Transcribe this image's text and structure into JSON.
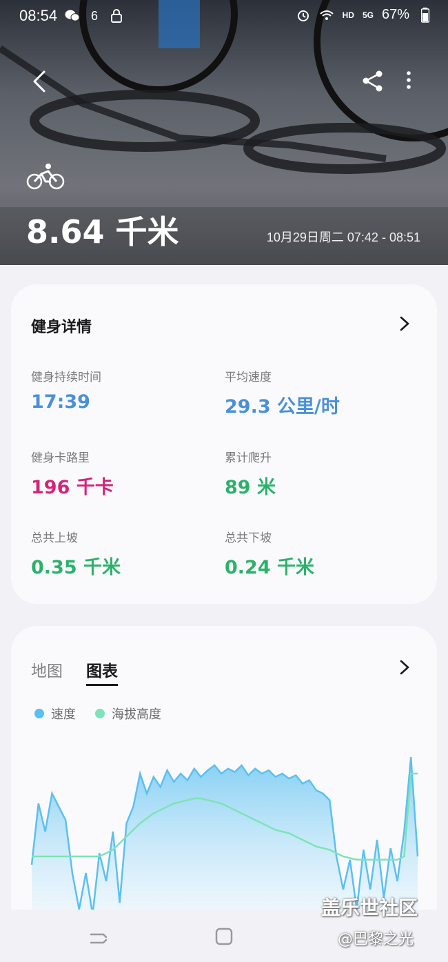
{
  "status_bar": {
    "time": "08:54",
    "left_icons": [
      "wechat-icon",
      "signal-6-icon",
      "lock-icon"
    ],
    "right_icons": [
      "alarm-icon",
      "wifi-icon",
      "hd-icon",
      "5g-icon",
      "battery-icon"
    ],
    "hd": "HD",
    "network": "5G",
    "battery": "67%"
  },
  "header": {
    "back_icon": "chevron-left-icon",
    "share_icon": "share-icon",
    "more_icon": "more-vertical-icon",
    "activity_icon": "bicycle-icon",
    "distance": "8.64 千米",
    "datetime": "10月29日周二 07:42 - 08:51"
  },
  "details": {
    "title": "健身详情",
    "stats": [
      {
        "label": "健身持续时间",
        "value": "17:39",
        "color": "#4a90d9"
      },
      {
        "label": "平均速度",
        "value": "29.3 公里/时",
        "color": "#4a90d9"
      },
      {
        "label": "健身卡路里",
        "value": "196 千卡",
        "color": "#d4237a"
      },
      {
        "label": "累计爬升",
        "value": "89 米",
        "color": "#2bb26a"
      },
      {
        "label": "总共上坡",
        "value": "0.35 千米",
        "color": "#2bb26a"
      },
      {
        "label": "总共下坡",
        "value": "0.24 千米",
        "color": "#2bb26a"
      }
    ]
  },
  "chart_card": {
    "tabs": [
      {
        "label": "地图",
        "selected": false
      },
      {
        "label": "图表",
        "selected": true
      }
    ],
    "legend": [
      {
        "label": "速度",
        "color": "#5bc0f0"
      },
      {
        "label": "海拔高度",
        "color": "#7de3b8"
      }
    ]
  },
  "chart_data": {
    "type": "area",
    "title": "",
    "xlabel": "",
    "ylabel": "",
    "series": [
      {
        "name": "速度",
        "color": "#5bc0f0",
        "values": [
          0.35,
          0.72,
          0.55,
          0.78,
          0.7,
          0.62,
          0.3,
          0.08,
          0.3,
          0.05,
          0.42,
          0.25,
          0.55,
          0.12,
          0.6,
          0.7,
          0.9,
          0.78,
          0.88,
          0.82,
          0.92,
          0.85,
          0.9,
          0.86,
          0.93,
          0.88,
          0.92,
          0.95,
          0.9,
          0.93,
          0.91,
          0.95,
          0.89,
          0.93,
          0.9,
          0.92,
          0.88,
          0.9,
          0.87,
          0.89,
          0.84,
          0.86,
          0.8,
          0.78,
          0.74,
          0.4,
          0.2,
          0.38,
          0.08,
          0.44,
          0.2,
          0.5,
          0.15,
          0.45,
          0.25,
          0.55,
          1.0,
          0.4
        ]
      },
      {
        "name": "海拔高度",
        "color": "#7de3b8",
        "values": [
          0.4,
          0.4,
          0.4,
          0.4,
          0.4,
          0.4,
          0.4,
          0.4,
          0.4,
          0.4,
          0.4,
          0.42,
          0.44,
          0.48,
          0.52,
          0.56,
          0.6,
          0.63,
          0.66,
          0.68,
          0.7,
          0.72,
          0.73,
          0.74,
          0.75,
          0.75,
          0.74,
          0.73,
          0.72,
          0.7,
          0.68,
          0.66,
          0.64,
          0.62,
          0.6,
          0.58,
          0.56,
          0.55,
          0.54,
          0.52,
          0.5,
          0.48,
          0.46,
          0.45,
          0.44,
          0.42,
          0.4,
          0.39,
          0.38,
          0.38,
          0.38,
          0.38,
          0.38,
          0.38,
          0.38,
          0.4,
          0.9,
          0.9
        ]
      }
    ]
  },
  "nav": {
    "recent_icon": "recent-apps-icon",
    "home_icon": "home-icon"
  },
  "watermark": {
    "line1": "盖乐世社区",
    "line2": "@巴黎之光"
  }
}
